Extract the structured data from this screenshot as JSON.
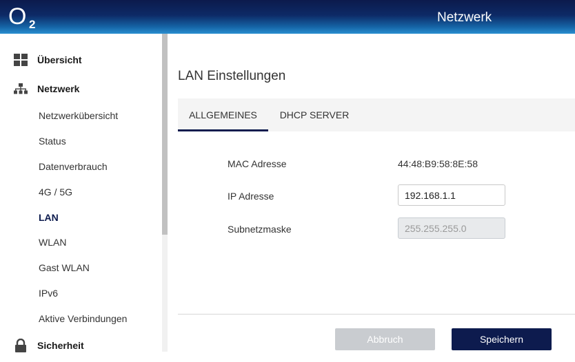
{
  "header": {
    "logo_letter": "O",
    "logo_sub": "2",
    "title": "Netzwerk"
  },
  "sidebar": {
    "sections": [
      {
        "label": "Übersicht",
        "icon": "grid-icon"
      },
      {
        "label": "Netzwerk",
        "icon": "network-icon"
      },
      {
        "label": "Sicherheit",
        "icon": "lock-icon"
      }
    ],
    "sub_items": [
      {
        "label": "Netzwerkübersicht",
        "active": false
      },
      {
        "label": "Status",
        "active": false
      },
      {
        "label": "Datenverbrauch",
        "active": false
      },
      {
        "label": "4G / 5G",
        "active": false
      },
      {
        "label": "LAN",
        "active": true
      },
      {
        "label": "WLAN",
        "active": false
      },
      {
        "label": "Gast WLAN",
        "active": false
      },
      {
        "label": "IPv6",
        "active": false
      },
      {
        "label": "Aktive Verbindungen",
        "active": false
      }
    ]
  },
  "main": {
    "title": "LAN Einstellungen",
    "tabs": [
      {
        "label": "ALLGEMEINES",
        "active": true
      },
      {
        "label": "DHCP SERVER",
        "active": false
      }
    ],
    "fields": {
      "mac_label": "MAC Adresse",
      "mac_value": "44:48:B9:58:8E:58",
      "ip_label": "IP Adresse",
      "ip_value": "192.168.1.1",
      "subnet_label": "Subnetzmaske",
      "subnet_value": "255.255.255.0"
    },
    "buttons": {
      "cancel": "Abbruch",
      "save": "Speichern"
    }
  },
  "colors": {
    "brand_dark": "#0d1b4e",
    "header_light": "#2a8fd0",
    "disabled_button": "#c9ccd0"
  }
}
